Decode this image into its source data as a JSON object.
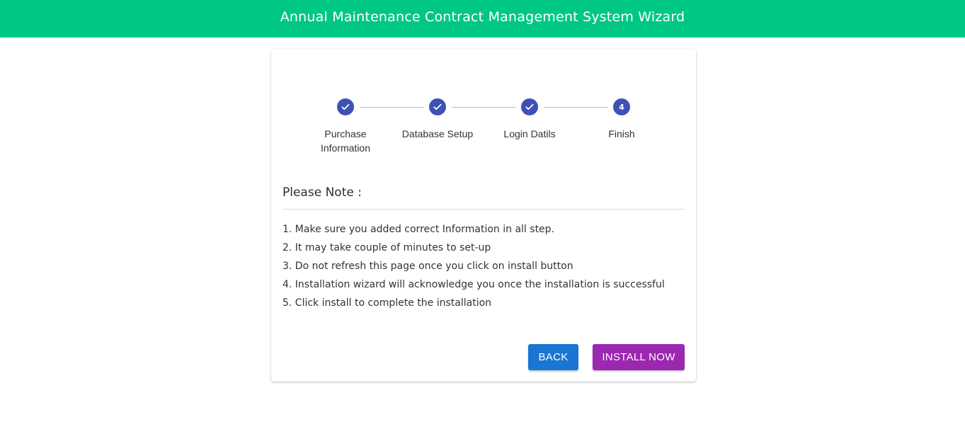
{
  "header": {
    "title": "Annual Maintenance Contract Management System Wizard"
  },
  "stepper": {
    "steps": [
      {
        "label": "Purchase Information",
        "state": "completed",
        "icon": "check-icon"
      },
      {
        "label": "Database Setup",
        "state": "completed",
        "icon": "check-icon"
      },
      {
        "label": "Login Datils",
        "state": "completed",
        "icon": "check-icon"
      },
      {
        "label": "Finish",
        "state": "active",
        "number": "4"
      }
    ]
  },
  "note": {
    "title": "Please Note :",
    "items": [
      "1. Make sure you added correct Information in all step.",
      "2. It may take couple of minutes to set-up",
      "3. Do not refresh this page once you click on install button",
      "4. Installation wizard will acknowledge you once the installation is successful",
      "5. Click install to complete the installation"
    ]
  },
  "actions": {
    "back_label": "BACK",
    "install_label": "INSTALL NOW"
  },
  "colors": {
    "header_bg": "#00c883",
    "step_circle": "#3f51b5",
    "back_button": "#1976d2",
    "install_button": "#9c27b0"
  }
}
